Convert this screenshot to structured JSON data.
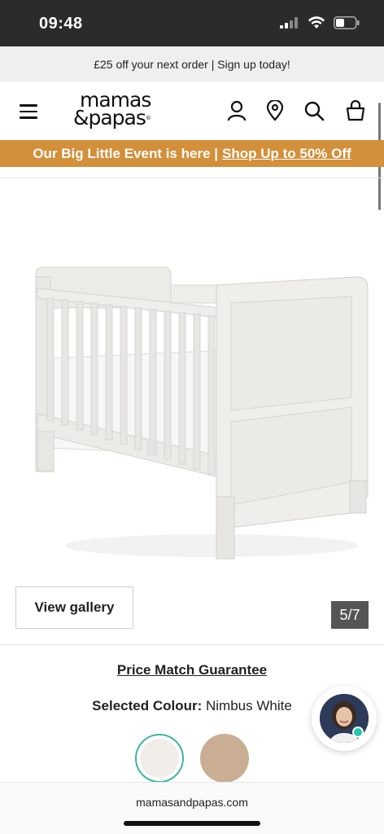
{
  "status_bar": {
    "time": "09:48",
    "icons": [
      "signal-icon",
      "wifi-icon",
      "battery-icon"
    ]
  },
  "promo": {
    "text": "£25 off your next order | Sign up today!"
  },
  "header": {
    "logo_line1": "mamas",
    "logo_line2": "&papas",
    "icons": [
      "menu-icon",
      "account-icon",
      "store-locator-icon",
      "search-icon",
      "basket-icon"
    ]
  },
  "event_banner": {
    "text": "Our Big Little Event is here |",
    "link": "Shop Up to 50% Off",
    "color": "#d38f3a"
  },
  "gallery": {
    "view_label": "View gallery",
    "counter": "5/7"
  },
  "product": {
    "price_match": "Price Match Guarantee",
    "colour_label": "Selected Colour:",
    "colour_value": "Nimbus White",
    "swatches": [
      {
        "name": "Nimbus White",
        "color": "#f1eeea",
        "selected": true
      },
      {
        "name": "Beige",
        "color": "#c9ae93",
        "selected": false
      }
    ]
  },
  "browser": {
    "url": "mamasandpapas.com"
  }
}
